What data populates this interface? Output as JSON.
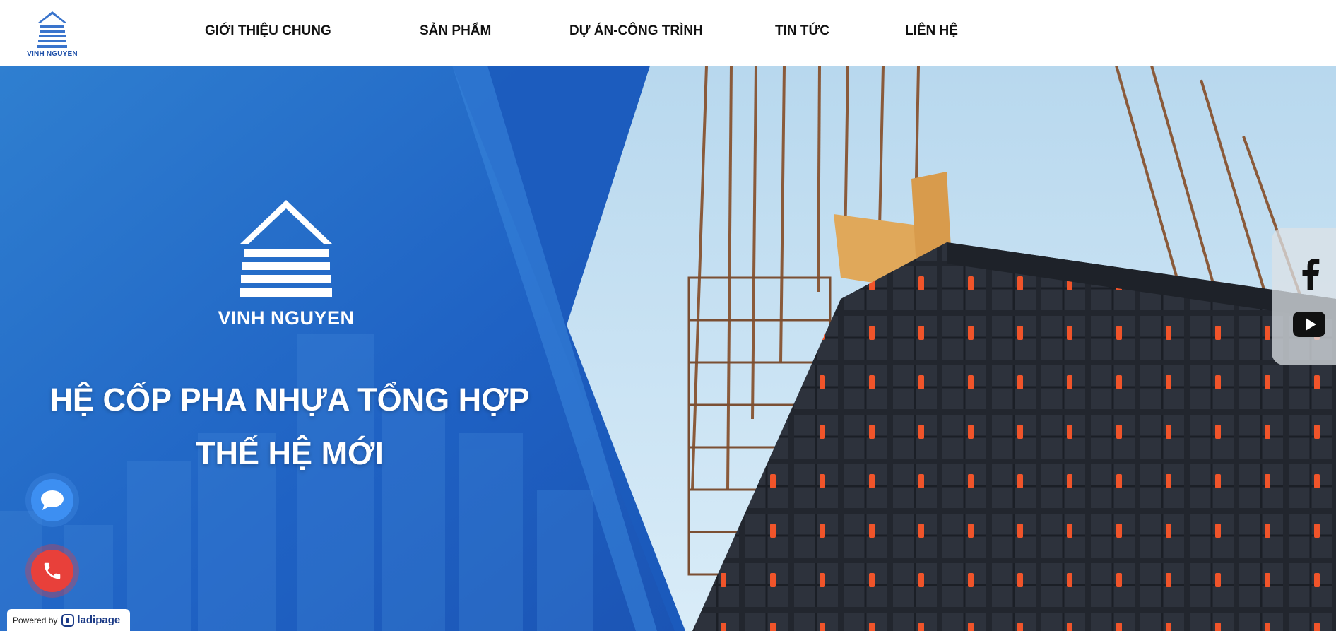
{
  "header": {
    "logo_text": "VINH NGUYEN",
    "nav": [
      {
        "label": "GIỚI THIỆU CHUNG"
      },
      {
        "label": "SẢN PHẨM"
      },
      {
        "label": "DỰ ÁN-CÔNG TRÌNH"
      },
      {
        "label": "TIN TỨC"
      },
      {
        "label": "LIÊN HỆ"
      }
    ]
  },
  "hero": {
    "brand": "VINH NGUYEN",
    "headline_line1": "HỆ CỐP PHA NHỰA TỔNG HỢP",
    "headline_line2": "THẾ HỆ MỚI"
  },
  "social": {
    "icons": [
      "facebook-icon",
      "youtube-icon"
    ]
  },
  "floating": {
    "icons": [
      "chat-icon",
      "phone-icon"
    ]
  },
  "powered": {
    "prefix": "Powered by",
    "brand": "ladipage"
  },
  "colors": {
    "accent_blue": "#1f62c4",
    "logo_blue": "#1d4fa8",
    "call_red": "#e8403a",
    "chat_blue": "#3d8ff2"
  }
}
